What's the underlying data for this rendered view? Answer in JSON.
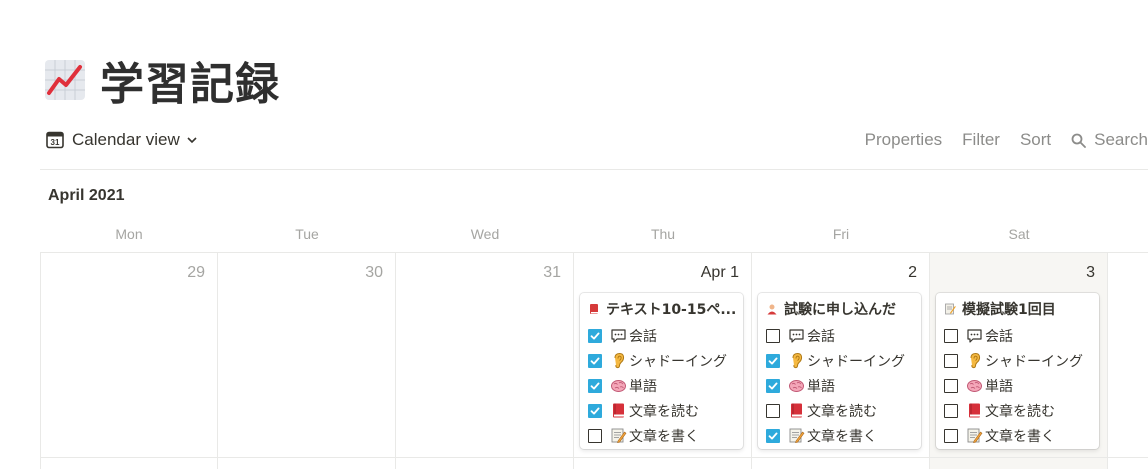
{
  "page": {
    "title": "学習記録",
    "icon": "chart-increasing-icon"
  },
  "view": {
    "label": "Calendar view",
    "icon": "calendar-31-icon"
  },
  "toolbar": {
    "properties": "Properties",
    "filter": "Filter",
    "sort": "Sort",
    "search": "Search"
  },
  "calendar": {
    "month_label": "April 2021",
    "weekdays": [
      "Mon",
      "Tue",
      "Wed",
      "Thu",
      "Fri",
      "Sat"
    ],
    "days": [
      "29",
      "30",
      "31",
      "Apr 1",
      "2",
      "3"
    ]
  },
  "property_labels": [
    "会話",
    "シャドーイング",
    "単語",
    "文章を読む",
    "文章を書く"
  ],
  "property_icons": [
    "speech-bubble-icon",
    "ear-icon",
    "brain-icon",
    "book-icon",
    "memo-icon"
  ],
  "cards": [
    {
      "title": "テキスト10-15ペ...",
      "icon": "red-book-icon",
      "checks": [
        true,
        true,
        true,
        true,
        false
      ]
    },
    {
      "title": "試験に申し込んだ",
      "icon": "person-icon",
      "checks": [
        false,
        true,
        true,
        false,
        true
      ]
    },
    {
      "title": "模擬試験1回目",
      "icon": "memo-icon",
      "checks": [
        false,
        false,
        false,
        false,
        false
      ]
    }
  ],
  "colors": {
    "checkbox_checked": "#2eaadc",
    "today_bg": "#f7f6f3",
    "muted_text": "#a5a5a2"
  }
}
